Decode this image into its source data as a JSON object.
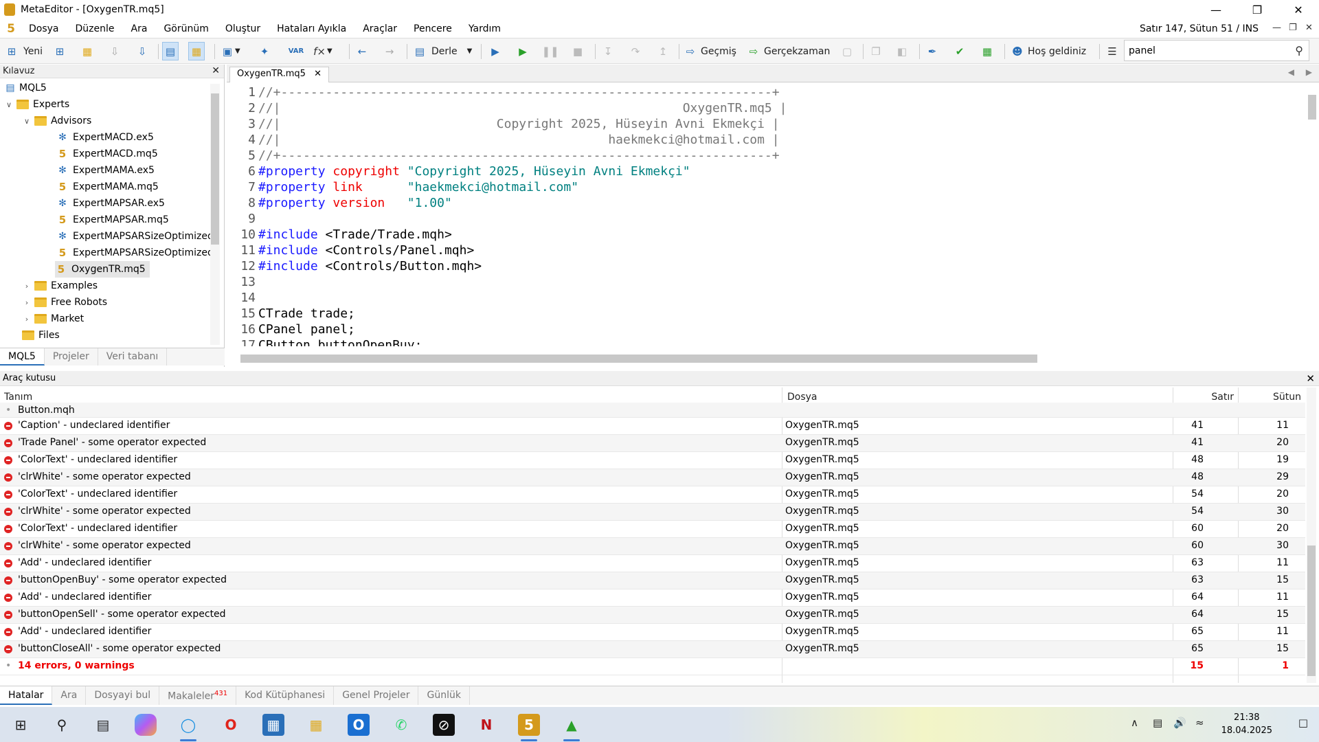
{
  "window": {
    "title": "MetaEditor - [OxygenTR.mq5]"
  },
  "menu": {
    "items": [
      "Dosya",
      "Düzenle",
      "Ara",
      "Görünüm",
      "Oluştur",
      "Hataları Ayıkla",
      "Araçlar",
      "Pencere",
      "Yardım"
    ],
    "status": "Satır 147, Sütun 51  /  INS"
  },
  "toolbar": {
    "new_label": "Yeni",
    "compile_label": "Derle",
    "history_label": "Geçmiş",
    "realtime_label": "Gerçekzaman",
    "welcome_label": "Hoş geldiniz",
    "search_value": "panel"
  },
  "navigator": {
    "title": "Kılavuz",
    "root": "MQL5",
    "experts": "Experts",
    "advisors": "Advisors",
    "files": [
      "ExpertMACD.ex5",
      "ExpertMACD.mq5",
      "ExpertMAMA.ex5",
      "ExpertMAMA.mq5",
      "ExpertMAPSAR.ex5",
      "ExpertMAPSAR.mq5",
      "ExpertMAPSARSizeOptimized",
      "ExpertMAPSARSizeOptimized",
      "OxygenTR.mq5"
    ],
    "folders": [
      "Examples",
      "Free Robots",
      "Market",
      "Files"
    ],
    "tabs": [
      "MQL5",
      "Projeler",
      "Veri tabanı"
    ]
  },
  "editor": {
    "tab": "OxygenTR.mq5",
    "lines": [
      {
        "n": "1",
        "t": "//+------------------------------------------------------------------+"
      },
      {
        "n": "2",
        "t": "//|                                                      OxygenTR.mq5 |"
      },
      {
        "n": "3",
        "t": "//|                             Copyright 2025, Hüseyin Avni Ekmekçi |"
      },
      {
        "n": "4",
        "t": "//|                                            haekmekci@hotmail.com |"
      },
      {
        "n": "5",
        "t": "//+------------------------------------------------------------------+"
      },
      {
        "n": "6",
        "kw": "#property",
        "pr": "copyright",
        "st": "\"Copyright 2025, Hüseyin Avni Ekmekçi\""
      },
      {
        "n": "7",
        "kw": "#property",
        "pr": "link",
        "st": "\"haekmekci@hotmail.com\""
      },
      {
        "n": "8",
        "kw": "#property",
        "pr": "version",
        "st": "\"1.00\""
      },
      {
        "n": "9",
        "t": ""
      },
      {
        "n": "10",
        "kw": "#include",
        "t": "<Trade/Trade.mqh>"
      },
      {
        "n": "11",
        "kw": "#include",
        "t": "<Controls/Panel.mqh>"
      },
      {
        "n": "12",
        "kw": "#include",
        "t": "<Controls/Button.mqh>"
      },
      {
        "n": "13",
        "t": ""
      },
      {
        "n": "14",
        "t": ""
      },
      {
        "n": "15",
        "t": "CTrade trade;"
      },
      {
        "n": "16",
        "t": "CPanel panel;"
      },
      {
        "n": "17",
        "t": "CButton buttonOpenBuy;"
      }
    ]
  },
  "toolbox": {
    "title": "Araç kutusu",
    "columns": [
      "Tanım",
      "Dosya",
      "Satır",
      "Sütun"
    ],
    "header_row": "Button.mqh",
    "errors": [
      {
        "desc": "'Caption' - undeclared identifier",
        "file": "OxygenTR.mq5",
        "line": "41",
        "col": "11"
      },
      {
        "desc": "'Trade Panel' - some operator expected",
        "file": "OxygenTR.mq5",
        "line": "41",
        "col": "20"
      },
      {
        "desc": "'ColorText' - undeclared identifier",
        "file": "OxygenTR.mq5",
        "line": "48",
        "col": "19"
      },
      {
        "desc": "'clrWhite' - some operator expected",
        "file": "OxygenTR.mq5",
        "line": "48",
        "col": "29"
      },
      {
        "desc": "'ColorText' - undeclared identifier",
        "file": "OxygenTR.mq5",
        "line": "54",
        "col": "20"
      },
      {
        "desc": "'clrWhite' - some operator expected",
        "file": "OxygenTR.mq5",
        "line": "54",
        "col": "30"
      },
      {
        "desc": "'ColorText' - undeclared identifier",
        "file": "OxygenTR.mq5",
        "line": "60",
        "col": "20"
      },
      {
        "desc": "'clrWhite' - some operator expected",
        "file": "OxygenTR.mq5",
        "line": "60",
        "col": "30"
      },
      {
        "desc": "'Add' - undeclared identifier",
        "file": "OxygenTR.mq5",
        "line": "63",
        "col": "11"
      },
      {
        "desc": "'buttonOpenBuy' - some operator expected",
        "file": "OxygenTR.mq5",
        "line": "63",
        "col": "15"
      },
      {
        "desc": "'Add' - undeclared identifier",
        "file": "OxygenTR.mq5",
        "line": "64",
        "col": "11"
      },
      {
        "desc": "'buttonOpenSell' - some operator expected",
        "file": "OxygenTR.mq5",
        "line": "64",
        "col": "15"
      },
      {
        "desc": "'Add' - undeclared identifier",
        "file": "OxygenTR.mq5",
        "line": "65",
        "col": "11"
      },
      {
        "desc": "'buttonCloseAll' - some operator expected",
        "file": "OxygenTR.mq5",
        "line": "65",
        "col": "15"
      }
    ],
    "summary": {
      "desc": "14 errors, 0 warnings",
      "line": "15",
      "col": "1"
    },
    "tabs": [
      "Hatalar",
      "Ara",
      "Dosyayi bul",
      "Makaleler",
      "Kod Kütüphanesi",
      "Genel Projeler",
      "Günlük"
    ],
    "articles_badge": "431"
  },
  "taskbar": {
    "time": "21:38",
    "date": "18.04.2025"
  },
  "colors": {
    "accent": "#2a6fb8",
    "mql_orange": "#d49a1c",
    "error": "#e02424"
  }
}
